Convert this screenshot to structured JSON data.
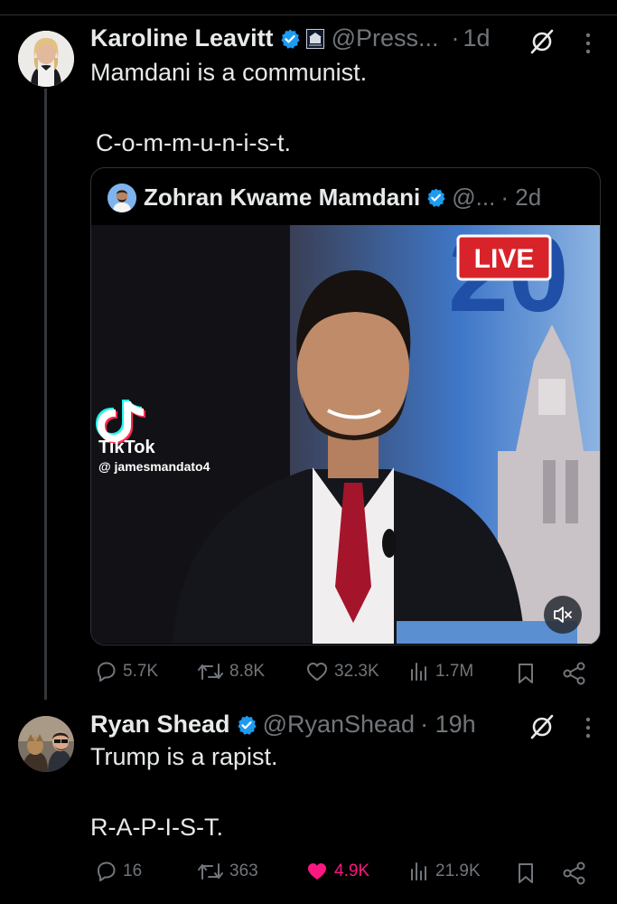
{
  "tweet1": {
    "display_name": "Karoline Leavitt",
    "handle": "@Press...",
    "dot": "·",
    "time": "1d",
    "text_line1": "Mamdani is a communist.",
    "text_line2": "C-o-m-m-u-n-i-s-t.",
    "quoted": {
      "display_name": "Zohran Kwame Mamdani",
      "handle": "@...",
      "time": "· 2d",
      "video": {
        "live_badge": "LIVE",
        "tiktok_label": "TikTok",
        "tiktok_user": "@ jamesmandato4",
        "background_number": "20"
      }
    },
    "actions": {
      "replies": "5.7K",
      "reposts": "8.8K",
      "likes": "32.3K",
      "views": "1.7M"
    }
  },
  "tweet2": {
    "display_name": "Ryan Shead",
    "handle": "@RyanShead",
    "time": "· 19h",
    "text_line1": "Trump is a rapist.",
    "text_line2": "R-A-P-I-S-T.",
    "actions": {
      "replies": "16",
      "reposts": "363",
      "likes": "4.9K",
      "views": "21.9K"
    }
  },
  "colors": {
    "background": "#000000",
    "text": "#e7e9ea",
    "muted": "#71767b",
    "verified": "#1d9bf0",
    "liked": "#f91880",
    "live_red": "#d8232a"
  },
  "icons": [
    "verified-badge-icon",
    "white-house-badge-icon",
    "grok-icon",
    "more-icon",
    "reply-icon",
    "repost-icon",
    "like-icon",
    "views-icon",
    "bookmark-icon",
    "share-icon",
    "mute-icon",
    "tiktok-logo-icon"
  ]
}
